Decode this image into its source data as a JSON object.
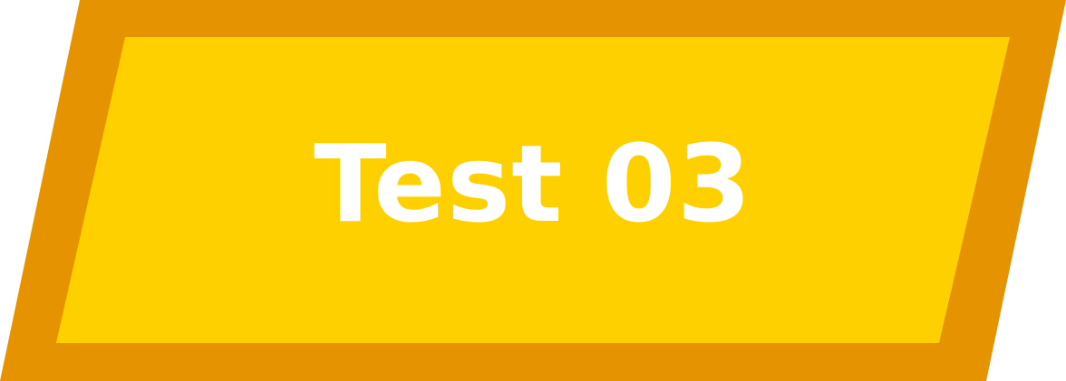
{
  "button": {
    "label": "Test 03",
    "fill_color": "#FFD000",
    "border_color": "#E59400",
    "text_color": "#FFFFFF"
  }
}
